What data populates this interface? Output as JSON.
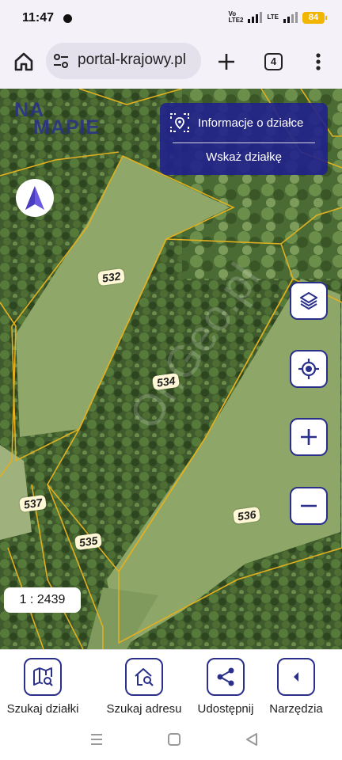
{
  "status_bar": {
    "time": "11:47",
    "network_label_1_top": "Vo",
    "network_label_1_bottom": "LTE2",
    "network_label_2": "LTE",
    "battery": "84"
  },
  "browser": {
    "url": "portal-krajowy.pl",
    "tab_count": "4",
    "icons": [
      "home-icon",
      "site-settings-icon",
      "plus-icon",
      "tabs-icon",
      "menu-icon"
    ]
  },
  "map": {
    "logo_line1": "NA",
    "logo_line2": "MAPIE",
    "info_panel": {
      "title": "Informacje o działce",
      "link": "Wskaż działkę"
    },
    "scale": "1 : 2439",
    "parcels": [
      {
        "label": "532"
      },
      {
        "label": "534"
      },
      {
        "label": "536"
      },
      {
        "label": "537"
      },
      {
        "label": "535"
      }
    ],
    "controls": [
      "layers-icon",
      "locate-icon",
      "zoom-in-icon",
      "zoom-out-icon"
    ],
    "colors": {
      "accent": "#2a2f8a",
      "panel": "#21218c",
      "parcel_border": "#e0b020"
    }
  },
  "toolbar": {
    "items": [
      {
        "label": "Szukaj działki",
        "icon": "map-search-icon"
      },
      {
        "label": "Szukaj adresu",
        "icon": "home-search-icon"
      },
      {
        "label": "Udostępnij",
        "icon": "share-icon"
      },
      {
        "label": "Narzędzia",
        "icon": "chevron-left-icon"
      }
    ]
  },
  "nav_bar": {
    "icons": [
      "recents-icon",
      "home-icon",
      "back-icon"
    ]
  }
}
